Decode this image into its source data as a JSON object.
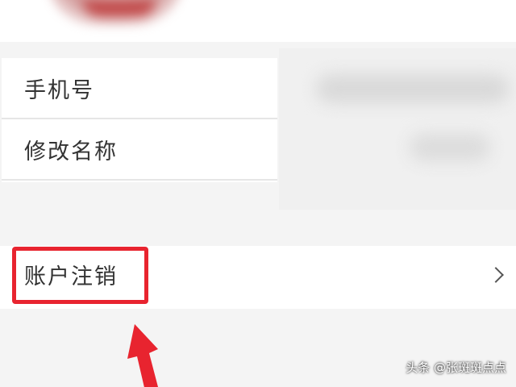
{
  "settings": {
    "items": [
      {
        "label": "手机号"
      },
      {
        "label": "修改名称"
      }
    ]
  },
  "account": {
    "cancel_label": "账户注销"
  },
  "colors": {
    "highlight": "#e8242f",
    "text": "#333333",
    "background": "#f4f4f4"
  },
  "icons": {
    "row_chevron": "chevron-right-icon",
    "pointer": "red-arrow-annotation-icon"
  },
  "watermark": {
    "text": "头条 @张斑斑点点"
  }
}
